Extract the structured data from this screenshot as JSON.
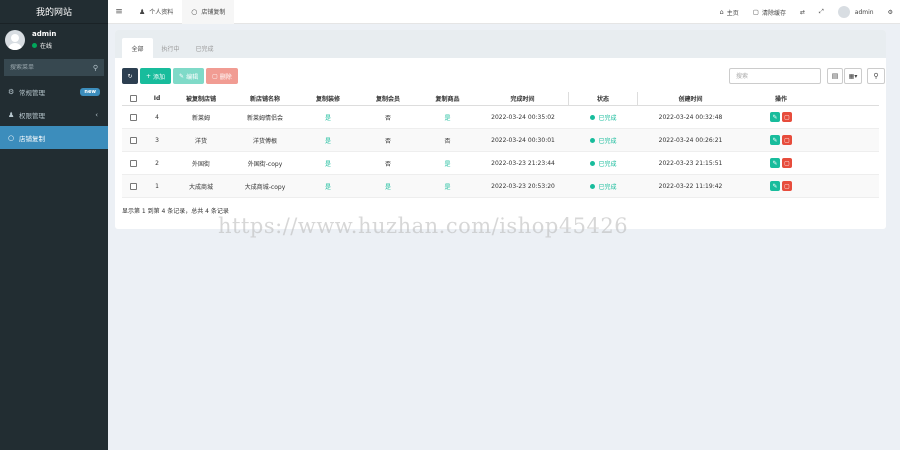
{
  "sidebar": {
    "title": "我的网站",
    "user": {
      "name": "admin",
      "status": "在线"
    },
    "search_placeholder": "搜索菜单",
    "items": [
      {
        "label": "常规管理",
        "badge": "new"
      },
      {
        "label": "权限管理"
      },
      {
        "label": "店铺复制"
      }
    ]
  },
  "header": {
    "tabs": [
      {
        "label": "个人资料"
      },
      {
        "label": "店铺复制"
      }
    ],
    "home": "主页",
    "clear_cache": "清除缓存",
    "user": "admin"
  },
  "content": {
    "tabs": [
      "全部",
      "执行中",
      "已完成"
    ],
    "toolbar": {
      "add": "添加",
      "edit": "编辑",
      "delete": "删除"
    },
    "search_placeholder": "搜索",
    "columns": [
      "Id",
      "被复制店铺",
      "新店铺名称",
      "复制装修",
      "复制会员",
      "复制商品",
      "完成时间",
      "状态",
      "创建时间",
      "操作"
    ],
    "rows": [
      {
        "id": "4",
        "source": "新莱姆",
        "new_name": "新莱姆情侣会",
        "decor": "是",
        "member": "否",
        "goods": "是",
        "done": "2022-03-24 00:35:02",
        "status": "已完成",
        "created": "2022-03-24 00:32:48"
      },
      {
        "id": "3",
        "source": "洋货",
        "new_name": "洋货傅根",
        "decor": "是",
        "member": "否",
        "goods": "否",
        "done": "2022-03-24 00:30:01",
        "status": "已完成",
        "created": "2022-03-24 00:26:21"
      },
      {
        "id": "2",
        "source": "外国街",
        "new_name": "外国街-copy",
        "decor": "是",
        "member": "否",
        "goods": "是",
        "done": "2022-03-23 21:23:44",
        "status": "已完成",
        "created": "2022-03-23 21:15:51"
      },
      {
        "id": "1",
        "source": "大成商城",
        "new_name": "大成商城-copy",
        "decor": "是",
        "member": "是",
        "goods": "是",
        "done": "2022-03-23 20:53:20",
        "status": "已完成",
        "created": "2022-03-22 11:19:42"
      }
    ],
    "summary": "显示第 1 到第 4 条记录，总共 4 条记录"
  },
  "watermark": "https://www.huzhan.com/ishop45426",
  "colors": {
    "sidebar_bg": "#222d32",
    "active_blue": "#3c8dbc",
    "success": "#18bc9c",
    "danger": "#e74c3c"
  }
}
